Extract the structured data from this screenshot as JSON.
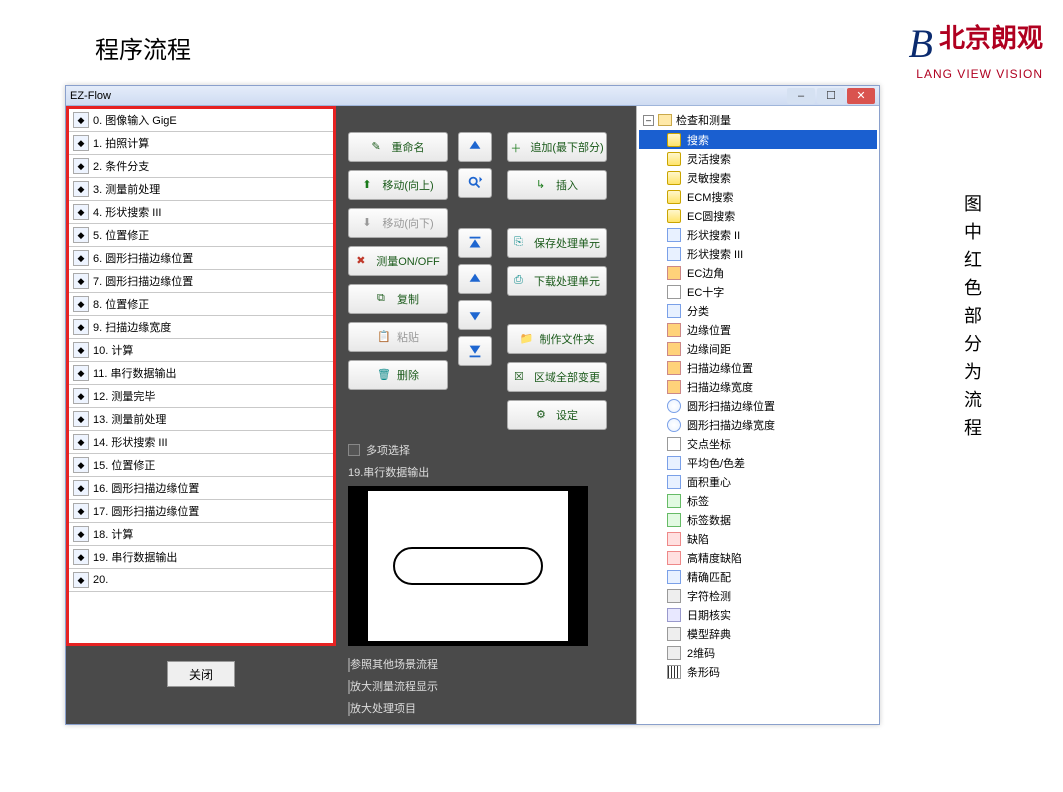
{
  "slide_title": "程序流程",
  "logo": {
    "cn": "北京朗观",
    "en": "LANG VIEW VISION"
  },
  "side_caption": "图中红色部分为流程",
  "window_title": "EZ-Flow",
  "flow": [
    {
      "n": "0",
      "label": "图像输入 GigE"
    },
    {
      "n": "1",
      "label": "拍照计算"
    },
    {
      "n": "2",
      "label": "条件分支"
    },
    {
      "n": "3",
      "label": "测量前处理"
    },
    {
      "n": "4",
      "label": "形状搜索 III"
    },
    {
      "n": "5",
      "label": "位置修正"
    },
    {
      "n": "6",
      "label": "圆形扫描边缘位置"
    },
    {
      "n": "7",
      "label": "圆形扫描边缘位置"
    },
    {
      "n": "8",
      "label": "位置修正"
    },
    {
      "n": "9",
      "label": "扫描边缘宽度"
    },
    {
      "n": "10",
      "label": "计算"
    },
    {
      "n": "11",
      "label": "串行数据输出"
    },
    {
      "n": "12",
      "label": "测量完毕"
    },
    {
      "n": "13",
      "label": "测量前处理"
    },
    {
      "n": "14",
      "label": "形状搜索 III"
    },
    {
      "n": "15",
      "label": "位置修正"
    },
    {
      "n": "16",
      "label": "圆形扫描边缘位置"
    },
    {
      "n": "17",
      "label": "圆形扫描边缘位置"
    },
    {
      "n": "18",
      "label": "计算"
    },
    {
      "n": "19",
      "label": "串行数据输出"
    },
    {
      "n": "20",
      "label": ""
    }
  ],
  "close_label": "关闭",
  "mid_buttons": {
    "rename": "重命名",
    "move_up": "移动(向上)",
    "move_down": "移动(向下)",
    "measure_toggle": "测量ON/OFF",
    "copy": "复制",
    "paste": "粘贴",
    "delete": "删除"
  },
  "right_buttons": {
    "append": "追加(最下部分)",
    "insert": "插入",
    "save_unit": "保存处理单元",
    "load_unit": "下载处理单元",
    "make_folder": "制作文件夹",
    "change_all": "区域全部变更",
    "settings": "设定"
  },
  "multi_select": "多项选择",
  "preview_title": "19.串行数据输出",
  "bottom_checks": {
    "ref_other": "参照其他场景流程",
    "enlarge_measure": "放大测量流程显示",
    "enlarge_item": "放大处理项目"
  },
  "tree_root": "检查和测量",
  "tree": [
    {
      "label": "搜索",
      "sel": true,
      "ic": "c-search"
    },
    {
      "label": "灵活搜索",
      "ic": "c-search"
    },
    {
      "label": "灵敏搜索",
      "ic": "c-search"
    },
    {
      "label": "ECM搜索",
      "ic": "c-search"
    },
    {
      "label": "EC圆搜索",
      "ic": "c-search"
    },
    {
      "label": "形状搜索 II",
      "ic": "c-shape"
    },
    {
      "label": "形状搜索 III",
      "ic": "c-shape"
    },
    {
      "label": "EC边角",
      "ic": "c-edge"
    },
    {
      "label": "EC十字",
      "ic": "c-cross"
    },
    {
      "label": "分类",
      "ic": "c-shape"
    },
    {
      "label": "边缘位置",
      "ic": "c-edge"
    },
    {
      "label": "边缘间距",
      "ic": "c-edge"
    },
    {
      "label": "扫描边缘位置",
      "ic": "c-edge"
    },
    {
      "label": "扫描边缘宽度",
      "ic": "c-edge"
    },
    {
      "label": "圆形扫描边缘位置",
      "ic": "c-circ"
    },
    {
      "label": "圆形扫描边缘宽度",
      "ic": "c-circ"
    },
    {
      "label": "交点坐标",
      "ic": "c-cross"
    },
    {
      "label": "平均色/色差",
      "ic": "c-shape"
    },
    {
      "label": "面积重心",
      "ic": "c-shape"
    },
    {
      "label": "标签",
      "ic": "c-label"
    },
    {
      "label": "标签数据",
      "ic": "c-label"
    },
    {
      "label": "缺陷",
      "ic": "c-defect"
    },
    {
      "label": "高精度缺陷",
      "ic": "c-defect"
    },
    {
      "label": "精确匹配",
      "ic": "c-shape"
    },
    {
      "label": "字符检测",
      "ic": "c-code"
    },
    {
      "label": "日期核实",
      "ic": "c-date"
    },
    {
      "label": "模型辞典",
      "ic": "c-code"
    },
    {
      "label": "2维码",
      "ic": "c-code"
    },
    {
      "label": "条形码",
      "ic": "c-bc"
    }
  ]
}
